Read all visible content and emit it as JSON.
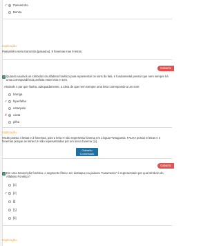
{
  "q1": {
    "options": [
      {
        "label": "Passarinho.",
        "mark": "✓",
        "checked": true
      },
      {
        "label": "Bonito.",
        "mark": "",
        "checked": false
      }
    ],
    "explanation_label": "Explicação:",
    "explanation_text": "Passarinho seria transcrita [pasaɾiɲu]. 8 fonemas mas 9 letras."
  },
  "q2": {
    "banner": "Gabarito",
    "question": "Quando usamos os símbolos do alfabeto fonético para representar os sons da fala, é fundamental pensar que nem sempre há uma correspondência perfeita entre letra e som.",
    "prompt": "Assinale o par que ilustra, adequadamente, a ideia de que nem sempre uma letra corresponde a um som:",
    "options": [
      {
        "label": "barriga",
        "mark": "",
        "checked": false
      },
      {
        "label": "hiperfalha",
        "mark": "✓",
        "checked": false
      },
      {
        "label": "estacpele",
        "mark": "",
        "checked": false
      },
      {
        "label": "casta",
        "mark": "✗",
        "checked": true
      },
      {
        "label": "pilha",
        "mark": "",
        "checked": false
      }
    ],
    "explanation_label": "Explicação:",
    "explanation_text": "HOJE possui 4 letras e 3 fonemas, pois a letra H não representa fonema em Língua Portuguesa. FALHA possui 5 letras e 4 fonemas porque as letras LH são representadas por um único fonema:  [ʎ].",
    "button_label": "Gabarito Comentado"
  },
  "q3": {
    "banner": "Gabarito",
    "question": "Em uma transcrição fonética, o segmento fônico em destaque na palavra \"casamento\" é representado por qual símbolo do Alfabeto Fonético?",
    "options": [
      {
        "label": "[s]",
        "mark": "",
        "checked": false
      },
      {
        "label": "[z]",
        "mark": "✓",
        "checked": false
      },
      {
        "label": "[ʃ]",
        "mark": "",
        "checked": false
      },
      {
        "label": "[ʒ]",
        "mark": "",
        "checked": false
      },
      {
        "label": "[k]",
        "mark": "",
        "checked": false
      }
    ],
    "explanation_label": "Explicação:"
  }
}
